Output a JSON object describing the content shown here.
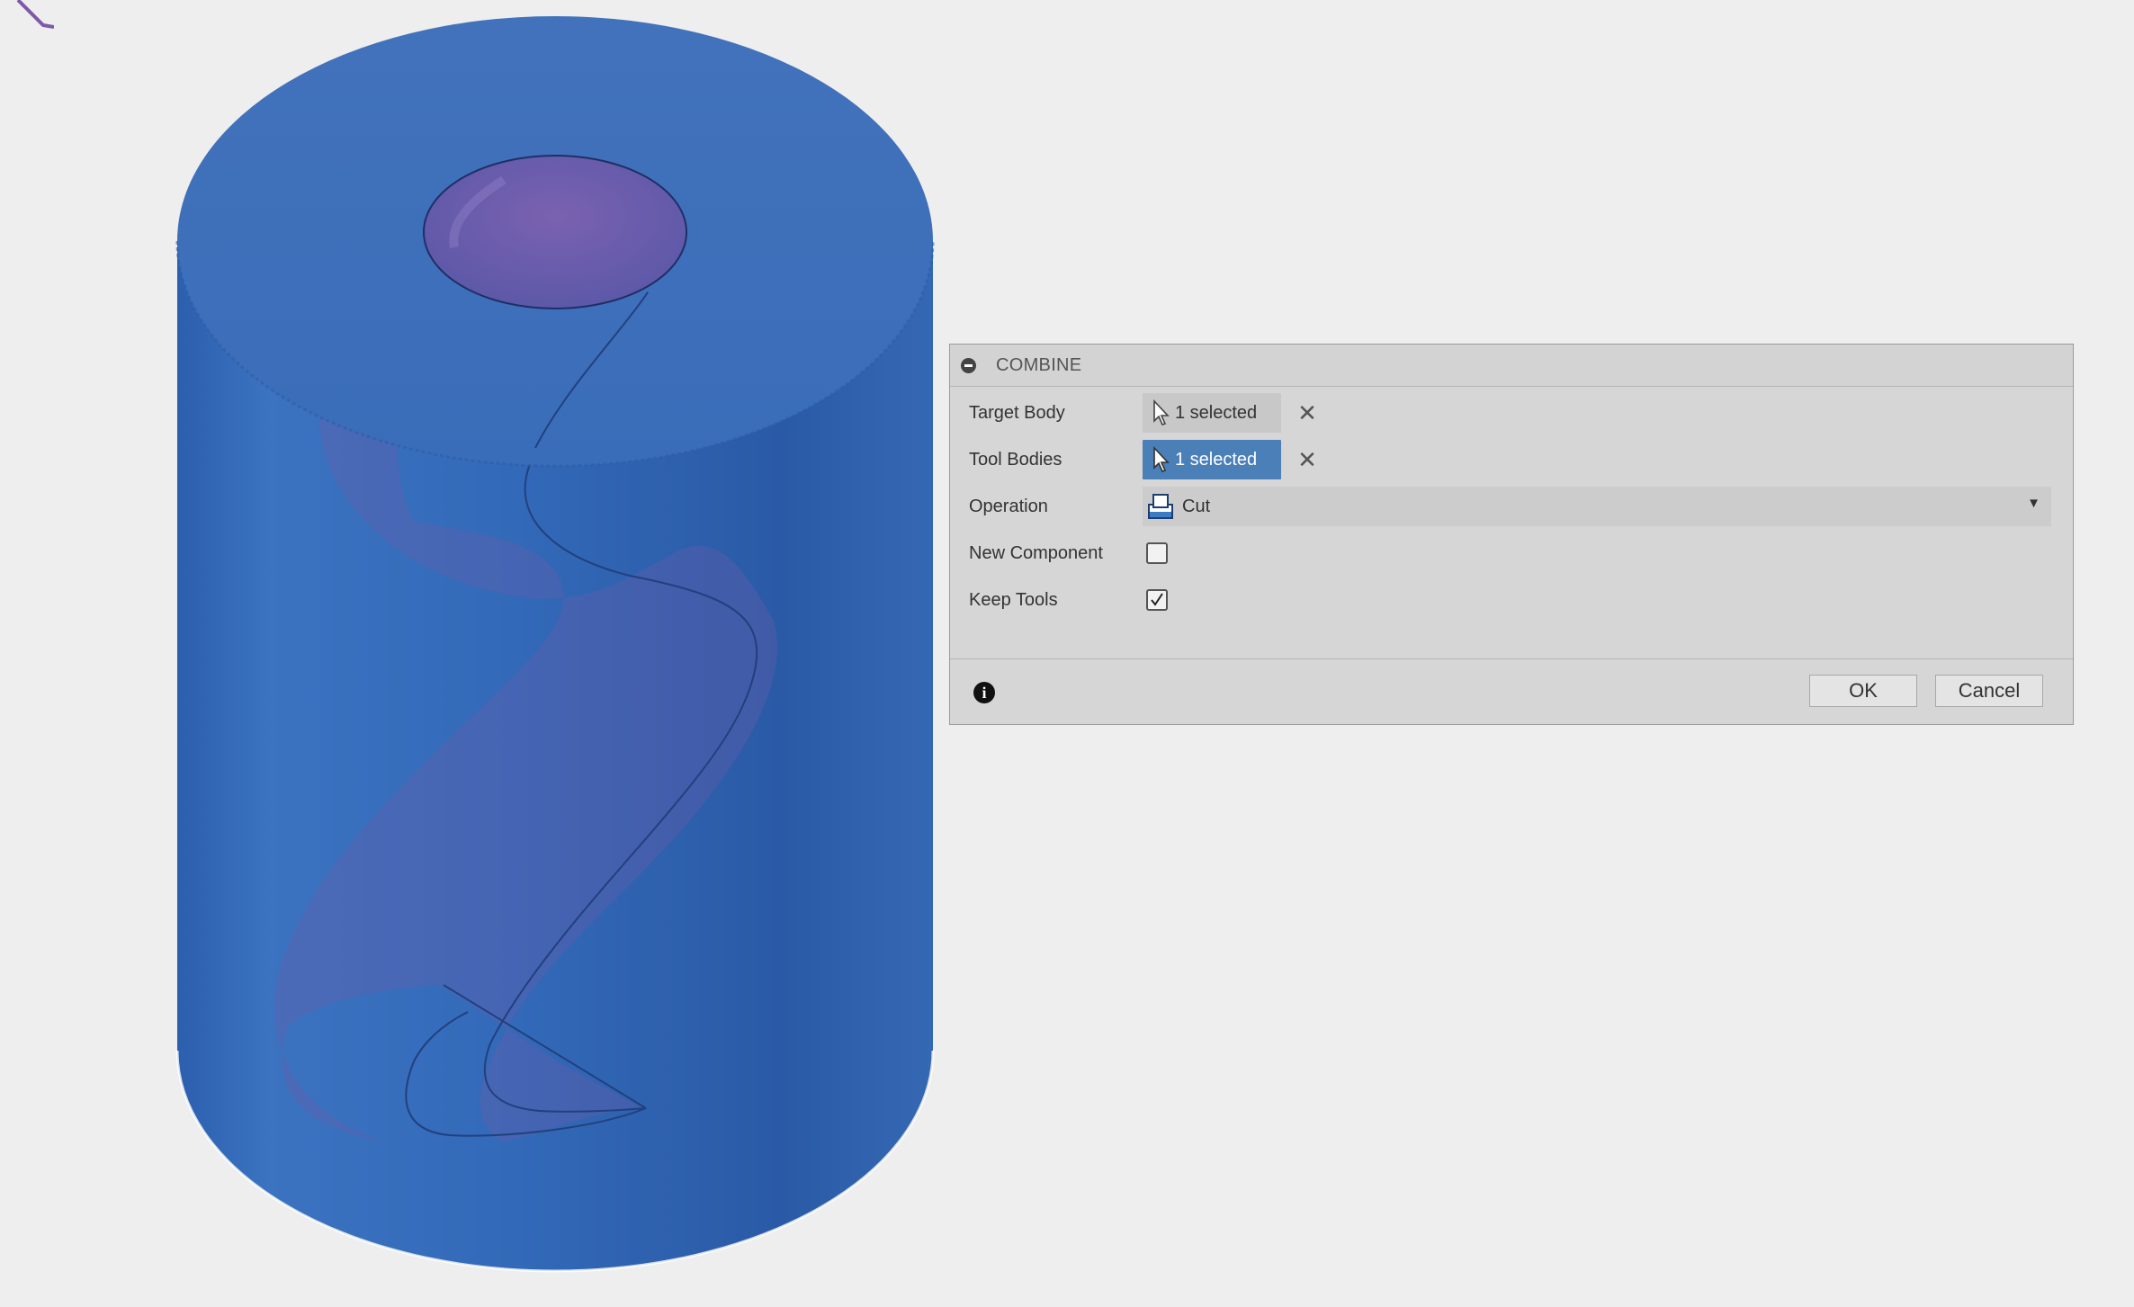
{
  "dialog": {
    "title": "COMBINE",
    "target_body": {
      "label": "Target Body",
      "value": "1 selected"
    },
    "tool_bodies": {
      "label": "Tool Bodies",
      "value": "1 selected"
    },
    "operation": {
      "label": "Operation",
      "value": "Cut"
    },
    "new_component": {
      "label": "New Component",
      "checked": false
    },
    "keep_tools": {
      "label": "Keep Tools",
      "checked": true
    },
    "ok_label": "OK",
    "cancel_label": "Cancel"
  },
  "colors": {
    "body_blue": "#2f66b4",
    "tool_purple": "#6a5ba8",
    "active_selection": "#4a7fb8",
    "dialog_bg": "#d6d6d6",
    "canvas_bg": "#eeeeee"
  },
  "icons": [
    "collapse-icon",
    "cursor-select-icon",
    "close-icon",
    "cut-operation-icon",
    "dropdown-arrow-icon",
    "checkmark-icon",
    "info-icon"
  ]
}
